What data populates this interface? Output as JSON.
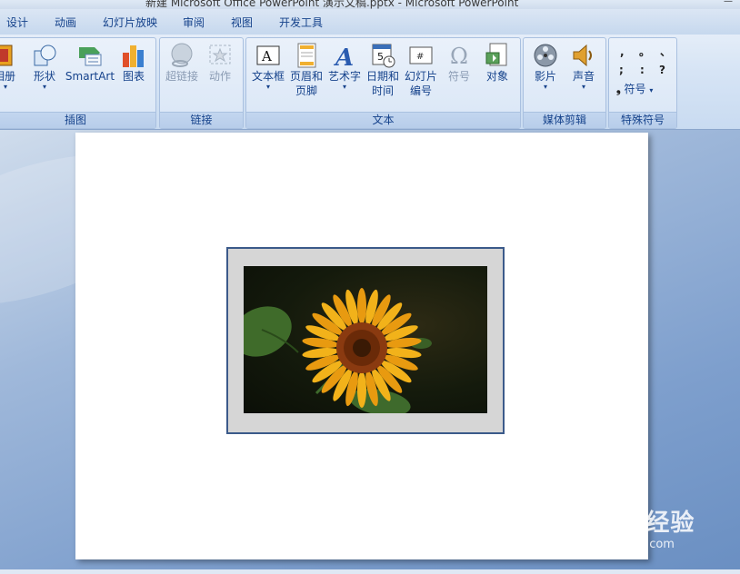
{
  "window": {
    "title": "新建 Microsoft Office PowerPoint 演示文稿.pptx - Microsoft PowerPoint"
  },
  "tabs": [
    "设计",
    "动画",
    "幻灯片放映",
    "审阅",
    "视图",
    "开发工具"
  ],
  "ribbon": {
    "groups": {
      "illustrations": {
        "label": "插图"
      },
      "links": {
        "label": "链接"
      },
      "text": {
        "label": "文本"
      },
      "media": {
        "label": "媒体剪辑"
      },
      "special": {
        "label": "特殊符号"
      }
    },
    "buttons": {
      "album": {
        "label": "相册"
      },
      "shapes": {
        "label": "形状"
      },
      "smartart": {
        "label": "SmartArt"
      },
      "chart": {
        "label": "图表"
      },
      "hyperlink": {
        "label": "超链接"
      },
      "action": {
        "label": "动作"
      },
      "textbox": {
        "label": "文本框"
      },
      "header_footer": {
        "label1": "页眉和",
        "label2": "页脚"
      },
      "wordart": {
        "label": "艺术字"
      },
      "datetime": {
        "label1": "日期和",
        "label2": "时间"
      },
      "slide_number": {
        "label1": "幻灯片",
        "label2": "编号"
      },
      "symbol": {
        "label": "符号"
      },
      "object": {
        "label": "对象"
      },
      "movie": {
        "label": "影片"
      },
      "sound": {
        "label": "声音"
      },
      "special_symbol": {
        "label": "符号"
      }
    },
    "special_symbols": [
      ",",
      "。",
      "、",
      ";",
      ":",
      "?"
    ]
  },
  "watermark": {
    "logo": "Baidu经验",
    "url": "jingyan.baidu.com"
  }
}
